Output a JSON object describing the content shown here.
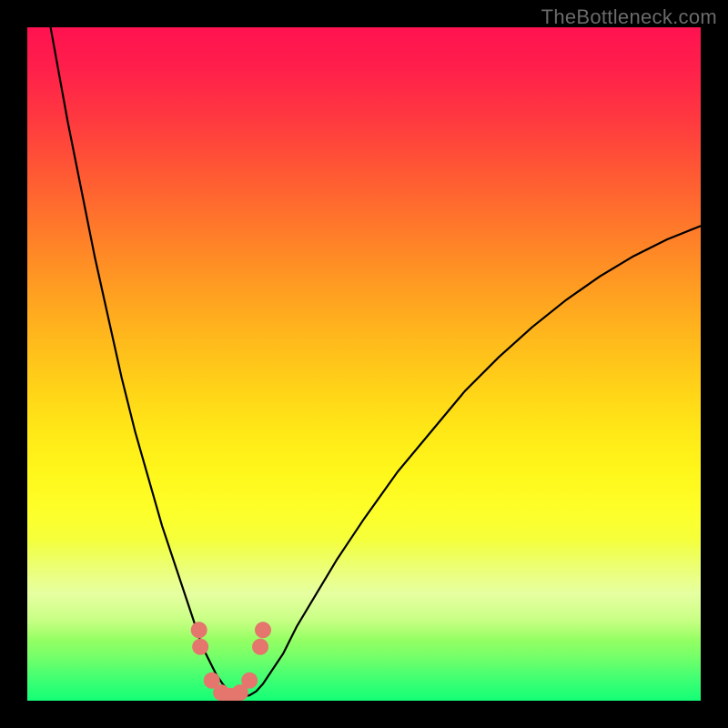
{
  "watermark": "TheBottleneck.com",
  "colors": {
    "frame_bg": "#000000",
    "watermark_text": "#6a6a6a",
    "curve_stroke": "#000000",
    "marker_fill": "#e4766d",
    "marker_stroke": "#9c4a44"
  },
  "chart_data": {
    "type": "line",
    "title": "",
    "xlabel": "",
    "ylabel": "",
    "xlim": [
      0,
      100
    ],
    "ylim": [
      0,
      100
    ],
    "x": [
      0,
      2,
      4,
      6,
      8,
      10,
      12,
      14,
      16,
      18,
      20,
      22,
      24,
      26,
      27,
      28,
      29,
      30,
      31,
      32,
      33,
      34,
      35,
      36,
      38,
      40,
      43,
      46,
      50,
      55,
      60,
      65,
      70,
      75,
      80,
      85,
      90,
      95,
      100
    ],
    "values": [
      120,
      108,
      97,
      86,
      76,
      66,
      57,
      48,
      40,
      33,
      26,
      20,
      14,
      8,
      6,
      4,
      2.5,
      1.4,
      0.8,
      0.6,
      0.8,
      1.4,
      2.5,
      4,
      7,
      11,
      16,
      21,
      27,
      34,
      40,
      46,
      51,
      55.5,
      59.5,
      63,
      66,
      68.5,
      70.5
    ],
    "grid": false,
    "legend": false,
    "gradient_stops": [
      {
        "pos": 0,
        "color": "#ff1250"
      },
      {
        "pos": 22,
        "color": "#ff5a33"
      },
      {
        "pos": 46,
        "color": "#ffb81c"
      },
      {
        "pos": 66,
        "color": "#fff71b"
      },
      {
        "pos": 88,
        "color": "#b6ff5d"
      },
      {
        "pos": 100,
        "color": "#13ff76"
      }
    ],
    "markers": {
      "x": [
        25.5,
        25.7,
        27.4,
        28.8,
        30.2,
        31.6,
        33.0,
        34.6,
        35.0
      ],
      "y": [
        10.5,
        8.0,
        3.0,
        1.2,
        0.7,
        1.2,
        3.0,
        8.0,
        10.5
      ]
    }
  }
}
